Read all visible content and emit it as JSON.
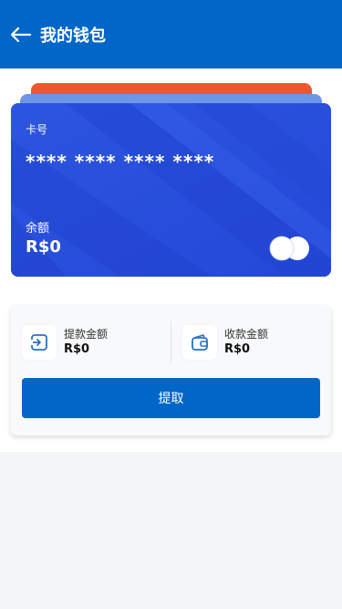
{
  "header": {
    "back_icon": "arrow-left-icon",
    "title": "我的钱包"
  },
  "colors": {
    "primary": "#0066c8",
    "card_blue": "#2b50de",
    "card_back_orange": "#f0572b",
    "card_back_blue": "#6f95e8"
  },
  "card": {
    "number_label": "卡号",
    "number": "**** **** **** ****",
    "balance_label": "余额",
    "balance": "R$0",
    "logo_icon": "card-brand-circles-icon"
  },
  "summary": {
    "withdraw": {
      "icon": "withdraw-icon",
      "label": "提款金额",
      "value": "R$0"
    },
    "receive": {
      "icon": "wallet-icon",
      "label": "收款金额",
      "value": "R$0"
    },
    "button_label": "提取"
  }
}
